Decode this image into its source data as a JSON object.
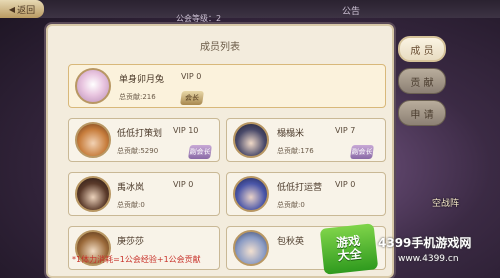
{
  "header": {
    "back_label": "返回",
    "guild_meta": "公会等级：2",
    "notice_tab": "公告"
  },
  "side_tabs": [
    {
      "label": "成 员",
      "active": true
    },
    {
      "label": "贡 献",
      "active": false
    },
    {
      "label": "申 请",
      "active": false
    }
  ],
  "panel": {
    "title": "成员列表"
  },
  "members": [
    {
      "name": "单身卯月兔",
      "vip": "VIP  0",
      "contribution": "总贡献:216",
      "badge": "会长"
    },
    {
      "name": "低低打策划",
      "vip": "VIP  10",
      "contribution": "总贡献:5290",
      "badge": "副会长"
    },
    {
      "name": "榻榻米",
      "vip": "VIP  7",
      "contribution": "总贡献:176",
      "badge": "副会长"
    },
    {
      "name": "禹冰岚",
      "vip": "VIP  0",
      "contribution": "总贡献:0",
      "badge": ""
    },
    {
      "name": "低低打运营",
      "vip": "VIP  0",
      "contribution": "总贡献:0",
      "badge": ""
    },
    {
      "name": "庚莎莎",
      "vip": "",
      "contribution": "",
      "badge": ""
    },
    {
      "name": "包秋英",
      "vip": "",
      "contribution": "",
      "badge": ""
    }
  ],
  "footer_note": "*1体力消耗=1公会经验+1公会贡献",
  "background": {
    "battle_label": "空战阵"
  },
  "watermark": {
    "logo_line1": "游戏",
    "logo_line2": "大全",
    "site_name": "4399手机游戏网",
    "site_url": "www.4399.cn"
  },
  "colors": {
    "panel_bg": "#f3ecdd",
    "panel_border": "#d8c9a8",
    "footer_red": "#c8322a",
    "watermark_green": "#2f9a1e"
  }
}
